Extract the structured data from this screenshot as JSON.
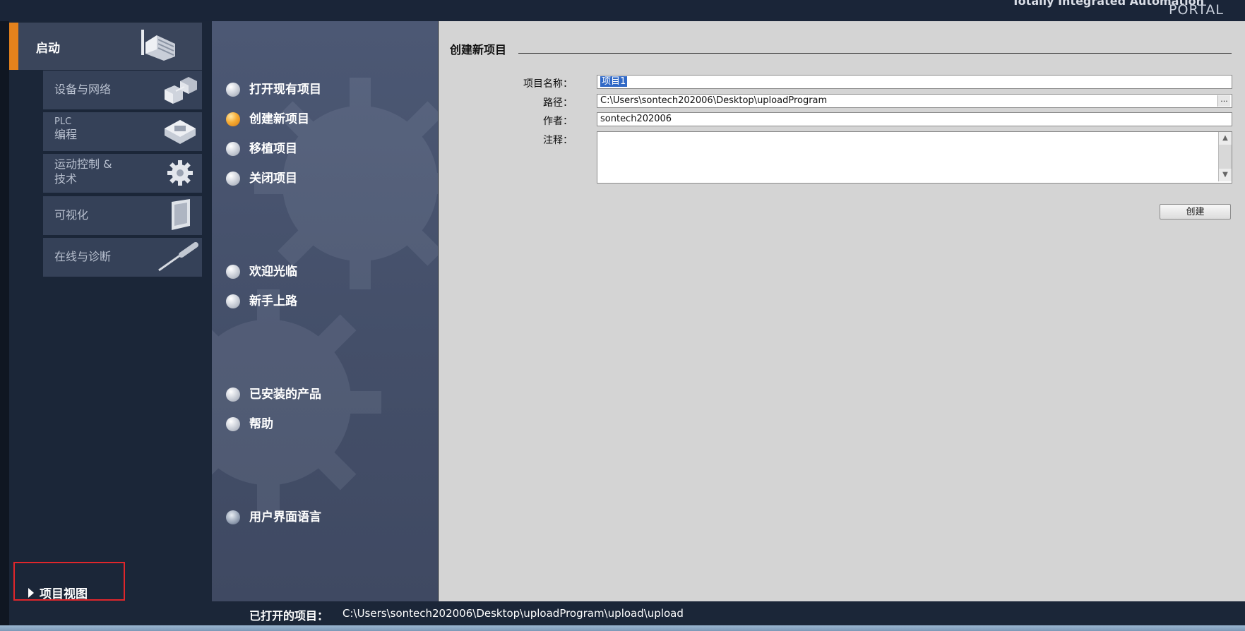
{
  "brand": {
    "line1": "Totally Integrated Automation",
    "line2": "PORTAL"
  },
  "left_nav": {
    "start": "启动",
    "items": [
      {
        "label": "设备与网络"
      },
      {
        "label1": "PLC",
        "label2": "编程"
      },
      {
        "label1": "运动控制 &",
        "label2": "技术"
      },
      {
        "label": "可视化"
      },
      {
        "label": "在线与诊断"
      }
    ],
    "project_view": "项目视图"
  },
  "menu": {
    "items": [
      "打开现有项目",
      "创建新项目",
      "移植项目",
      "关闭项目"
    ],
    "items2": [
      "欢迎光临",
      "新手上路"
    ],
    "items3": [
      "已安装的产品",
      "帮助"
    ],
    "language": "用户界面语言",
    "active": "创建新项目"
  },
  "form": {
    "title": "创建新项目",
    "name_label": "项目名称：",
    "name_value": "项目1",
    "path_label": "路径：",
    "path_value": "C:\\Users\\sontech202006\\Desktop\\uploadProgram",
    "browse": "...",
    "author_label": "作者：",
    "author_value": "sontech202006",
    "comment_label": "注释：",
    "comment_value": "",
    "create_button": "创建"
  },
  "status": {
    "opened_label": "已打开的项目：",
    "opened_path": "C:\\Users\\sontech202006\\Desktop\\uploadProgram\\upload\\upload"
  },
  "colors": {
    "accent": "#e5821c",
    "highlight_box": "#e0262b",
    "selection": "#3169c6"
  }
}
